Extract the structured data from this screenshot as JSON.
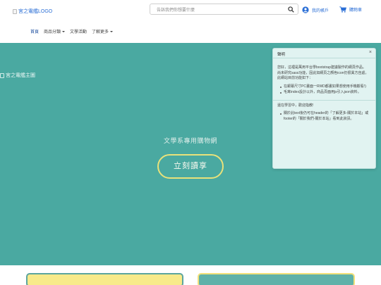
{
  "header": {
    "logo_alt": "宮之電艦LOGO",
    "search_placeholder": "告訴我們你想要什麼",
    "account_label": "我的帳戶",
    "cart_label": "購物車"
  },
  "nav": {
    "items": [
      {
        "label": "首頁",
        "active": true,
        "dropdown": false
      },
      {
        "label": "商品分類",
        "active": false,
        "dropdown": true
      },
      {
        "label": "文學活動",
        "active": false,
        "dropdown": false
      },
      {
        "label": "了解更多",
        "active": false,
        "dropdown": true
      }
    ]
  },
  "hero": {
    "image_alt": "宮之電艦主圖",
    "slogan": "文學系專用購物網",
    "cta_label": "立刻讀享"
  },
  "notice": {
    "title": "聲明",
    "close": "×",
    "para1": "您好，這裡是萬用平台學bootstrap建議製作的網頁作品。",
    "para2": "尚未研究sass功能，因此如網頁之顏色icon仍很異方自處。",
    "para3": "此網站目前功能如下：",
    "list1": [
      "在銀幕尺寸PC畫面一RWD都畫如果想使用手機觀看!)",
      "毛茸index設計以外，商品頁面用js引入json資料。"
    ],
    "para4": "還在學習中，歡迎指教!",
    "list2": [
      "關於此text後仍可在header的「了解更多-關於本站」或footer的「關於我們-關於本站」看到此資訊。"
    ]
  },
  "colors": {
    "hero_bg": "#4aa9a1",
    "cta_border": "#e9e27a",
    "link": "#2b6fd6",
    "card_yellow": "#f8ea8a",
    "card_teal": "#5fb1a9"
  }
}
